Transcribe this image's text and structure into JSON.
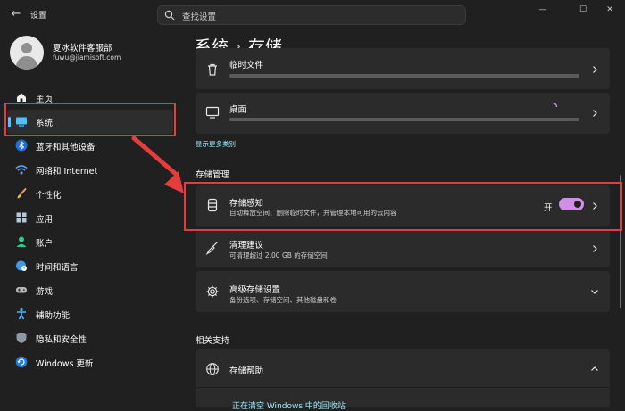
{
  "app": {
    "title": "设置",
    "back_glyph": "←"
  },
  "search": {
    "placeholder": "查找设置"
  },
  "window_controls": {
    "minimize": "—",
    "maximize": "☐",
    "close": "✕"
  },
  "profile": {
    "name": "夏冰软件客服部",
    "email": "fuwu@jiamisoft.com"
  },
  "sidebar": {
    "items": [
      {
        "label": "主页",
        "icon": "home-icon"
      },
      {
        "label": "系统",
        "icon": "system-icon",
        "selected": true
      },
      {
        "label": "蓝牙和其他设备",
        "icon": "bluetooth-icon"
      },
      {
        "label": "网络和 Internet",
        "icon": "network-icon"
      },
      {
        "label": "个性化",
        "icon": "brush-icon"
      },
      {
        "label": "应用",
        "icon": "apps-icon"
      },
      {
        "label": "账户",
        "icon": "account-icon"
      },
      {
        "label": "时间和语言",
        "icon": "globe-clock-icon"
      },
      {
        "label": "游戏",
        "icon": "gamepad-icon"
      },
      {
        "label": "辅助功能",
        "icon": "accessibility-icon"
      },
      {
        "label": "隐私和安全性",
        "icon": "shield-icon"
      },
      {
        "label": "Windows 更新",
        "icon": "update-icon"
      }
    ]
  },
  "breadcrumb": {
    "parent": "系统",
    "separator": "›",
    "current": "存储"
  },
  "storage_items": [
    {
      "title": "临时文件",
      "icon": "trash-icon"
    },
    {
      "title": "桌面",
      "icon": "monitor-icon"
    }
  ],
  "show_more": "显示更多类别",
  "storage_management": {
    "heading": "存储管理",
    "storage_sense": {
      "title": "存储感知",
      "subtitle": "自动释放空间、删除临时文件，并管理本地可用的云内容",
      "toggle_label": "开",
      "toggle_on": true,
      "icon": "storage-sense-icon"
    },
    "cleanup": {
      "title": "清理建议",
      "subtitle": "可清理超过 2.00 GB 的存储空间",
      "icon": "broom-icon"
    },
    "advanced": {
      "title": "高级存储设置",
      "subtitle": "备份选项、存储空间、其他磁盘和卷",
      "icon": "gear-icon"
    }
  },
  "related": {
    "heading": "相关支持",
    "help": {
      "title": "存储帮助",
      "icon": "globe-icon"
    },
    "link": "正在清空 Windows 中的回收站"
  },
  "colors": {
    "accent": "#4cc2ff",
    "toggle": "#d08ee8",
    "highlight": "#e53d3d",
    "card": "#2b2b2b",
    "background": "#202020"
  }
}
